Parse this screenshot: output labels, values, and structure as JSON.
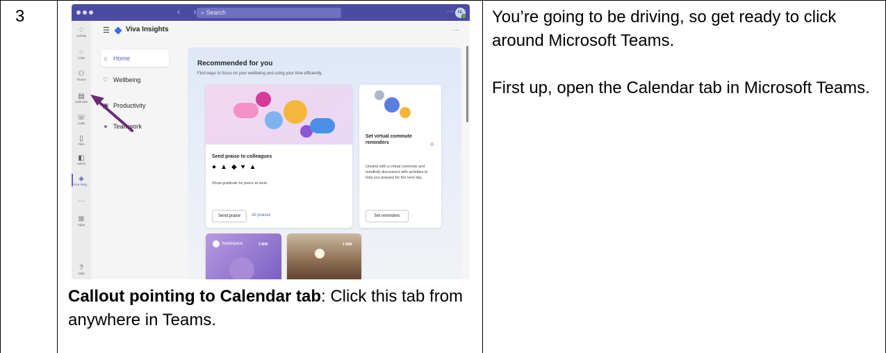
{
  "step_number": "3",
  "instructions": [
    "You’re going to be driving, so get ready to click around Microsoft Teams.",
    "First up, open the Calendar tab in Microsoft Teams."
  ],
  "caption": {
    "bold": "Callout pointing to Calendar tab",
    "text": ": Click this tab from anywhere in Teams."
  },
  "screenshot": {
    "search_placeholder": "Search",
    "avatar_initials": "NL",
    "app_title": "Viva Insights",
    "rail": [
      {
        "label": "Activity",
        "icon": "bell-icon"
      },
      {
        "label": "Chat",
        "icon": "chat-icon"
      },
      {
        "label": "Teams",
        "icon": "teams-icon"
      },
      {
        "label": "Calendar",
        "icon": "calendar-icon"
      },
      {
        "label": "Calls",
        "icon": "phone-icon"
      },
      {
        "label": "Files",
        "icon": "file-icon"
      },
      {
        "label": "Admin",
        "icon": "admin-icon"
      },
      {
        "label": "Viva Insig...",
        "icon": "viva-insights-icon"
      },
      {
        "label": "",
        "icon": "more-icon"
      },
      {
        "label": "Apps",
        "icon": "apps-icon"
      },
      {
        "label": "Help",
        "icon": "help-icon"
      }
    ],
    "nav": [
      {
        "label": "Home",
        "icon": "home-icon"
      },
      {
        "label": "Wellbeing",
        "icon": "heart-icon"
      },
      {
        "label": "Productivity",
        "icon": "productivity-icon"
      },
      {
        "label": "Teamwork",
        "icon": "teamwork-icon"
      }
    ],
    "panel_title": "Recommended for you",
    "panel_subtitle": "Find ways to focus on your wellbeing and using your time efficiently.",
    "card_praise": {
      "title": "Send praise to colleagues",
      "text": "Show gratitude for peers at work.",
      "button": "Send praise",
      "link": "All praises"
    },
    "card_commute": {
      "title": "Set virtual commute reminders",
      "text": "Unwind with a virtual commute and mindfully disconnect with activities to help you prepare for the next day.",
      "button": "Set reminders"
    },
    "card_headspace": {
      "brand": "headspace",
      "duration": "3 MIN"
    },
    "card_sunset": {
      "duration": "1 MIN"
    }
  },
  "colors": {
    "teams_purple": "#4b4ba4",
    "accent": "#5b5fc7",
    "callout_arrow": "#6a2a78"
  }
}
